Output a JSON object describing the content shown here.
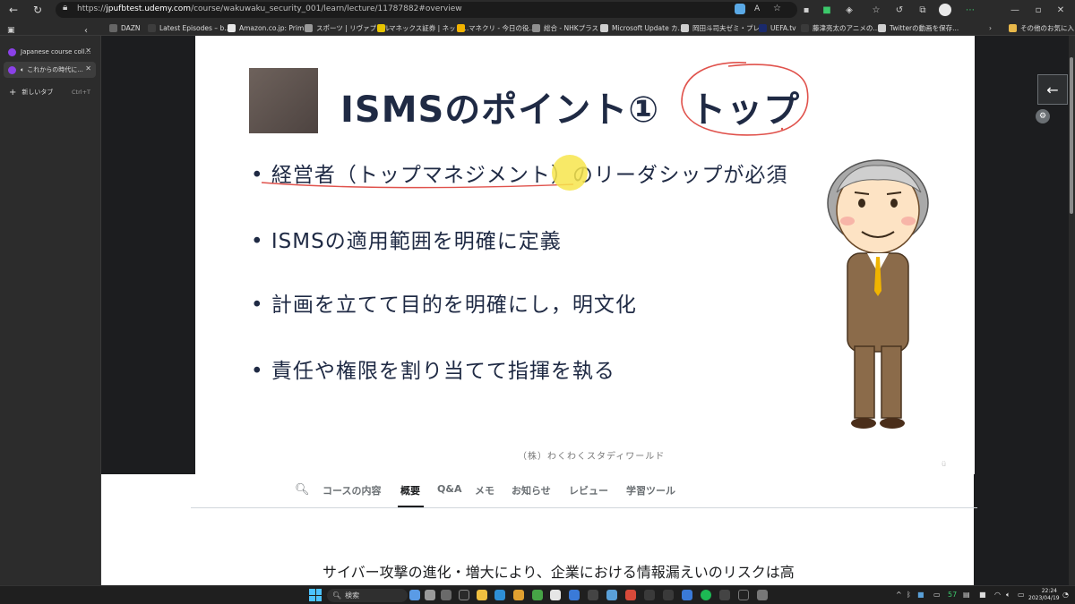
{
  "browser": {
    "url_prefix": "https://",
    "url_host": "jpufbtest.udemy.com",
    "url_path": "/course/wakuwaku_security_001/learn/lecture/11787882#overview"
  },
  "bookmarks": [
    {
      "label": "DAZN",
      "color": "#666666"
    },
    {
      "label": "Latest Episodes – b...",
      "color": "#3d3d3d"
    },
    {
      "label": "Amazon.co.jp: Prim...",
      "color": "#e6e6e6"
    },
    {
      "label": "スポーツ | リヴァプール",
      "color": "#9a9a9a"
    },
    {
      "label": "マネックス証券 | ネット...",
      "color": "#e7c400"
    },
    {
      "label": "マネクリ - 今日の役...",
      "color": "#f2b300"
    },
    {
      "label": "総合 - NHKプラス",
      "color": "#8f8f8f"
    },
    {
      "label": "Microsoft Update カ...",
      "color": "#cfcfcf"
    },
    {
      "label": "岡田斗司夫ゼミ・プレ...",
      "color": "#cfcfcf"
    },
    {
      "label": "UEFA.tv",
      "color": "#1a2a6c"
    },
    {
      "label": "藤津亮太のアニメの...",
      "color": "#3a3a3a"
    },
    {
      "label": "Twitterの動画を保存...",
      "color": "#cfcfcf"
    },
    {
      "label": "その他のお気に入り",
      "color": "#e8b84a"
    }
  ],
  "sidebar": {
    "tabs": [
      {
        "label": "Japanese course coll...",
        "active": false
      },
      {
        "label": "これからの時代に...",
        "active": true
      }
    ],
    "new_tab": {
      "label": "新しいタブ",
      "shortcut": "Ctrl+T"
    }
  },
  "slide": {
    "title_main": "ISMSのポイント①",
    "title_accent": "トップ",
    "bullets": [
      "経営者（トップマネジメント）のリーダシップが必須",
      "ISMSの適用範囲を明確に定義",
      "計画を立てて目的を明確にし，明文化",
      "責任や権限を割り当てて指揮を執る"
    ],
    "footer": "（株）わくわくスタディワールド"
  },
  "course_tabs": [
    "コースの内容",
    "概要",
    "Q&A",
    "メモ",
    "お知らせ",
    "レビュー",
    "学習ツール"
  ],
  "active_tab": "概要",
  "description": "サイバー攻撃の進化・増大により、企業における情報漏えいのリスクは高",
  "taskbar": {
    "search_placeholder": "検索",
    "tray_number": "57",
    "time": "22:24",
    "date": "2023/04/19"
  },
  "colors": {
    "accent_red": "#e0524c",
    "highlight_yellow": "#f7e54c",
    "slide_text": "#1f2a44"
  }
}
